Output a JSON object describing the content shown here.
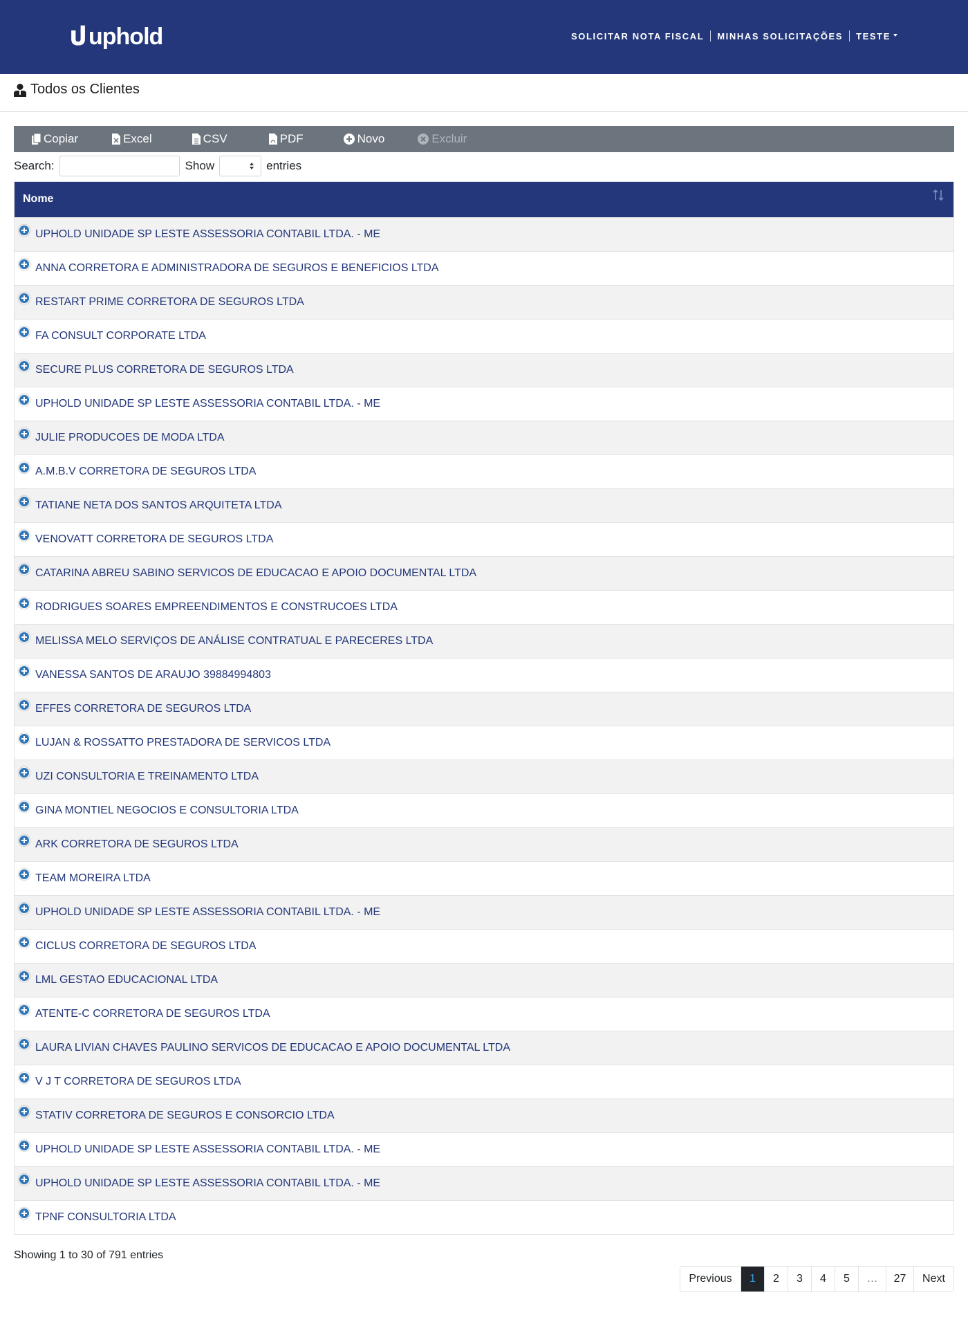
{
  "brand": {
    "name": "uphold"
  },
  "nav": {
    "links": [
      {
        "label": "SOLICITAR NOTA FISCAL"
      },
      {
        "label": "MINHAS SOLICITAÇÕES"
      },
      {
        "label": "TESTE"
      }
    ]
  },
  "page": {
    "title": "Todos os Clientes",
    "icon": "user-icon"
  },
  "toolbar": {
    "buttons": [
      {
        "label": "Copiar",
        "icon": "copy-icon",
        "enabled": true
      },
      {
        "label": "Excel",
        "icon": "excel-file-icon",
        "enabled": true
      },
      {
        "label": "CSV",
        "icon": "csv-file-icon",
        "enabled": true
      },
      {
        "label": "PDF",
        "icon": "pdf-file-icon",
        "enabled": true
      },
      {
        "label": "Novo",
        "icon": "plus-circle-icon",
        "enabled": true
      },
      {
        "label": "Excluir",
        "icon": "x-circle-icon",
        "enabled": false
      }
    ]
  },
  "controls": {
    "search_label": "Search:",
    "search_value": "",
    "show_label": "Show",
    "show_value": "",
    "entries_label": "entries"
  },
  "table": {
    "column": "Nome",
    "rows": [
      "UPHOLD UNIDADE SP LESTE ASSESSORIA CONTABIL LTDA. - ME",
      "ANNA CORRETORA E ADMINISTRADORA DE SEGUROS E BENEFICIOS LTDA",
      "RESTART PRIME CORRETORA DE SEGUROS LTDA",
      "FA CONSULT CORPORATE LTDA",
      "SECURE PLUS CORRETORA DE SEGUROS LTDA",
      "UPHOLD UNIDADE SP LESTE ASSESSORIA CONTABIL LTDA. - ME",
      "JULIE PRODUCOES DE MODA LTDA",
      "A.M.B.V CORRETORA DE SEGUROS LTDA",
      "TATIANE NETA DOS SANTOS ARQUITETA LTDA",
      "VENOVATT CORRETORA DE SEGUROS LTDA",
      "CATARINA ABREU SABINO SERVICOS DE EDUCACAO E APOIO DOCUMENTAL LTDA",
      "RODRIGUES SOARES EMPREENDIMENTOS E CONSTRUCOES LTDA",
      "MELISSA MELO SERVIÇOS DE ANÁLISE CONTRATUAL E PARECERES LTDA",
      "VANESSA SANTOS DE ARAUJO 39884994803",
      "EFFES CORRETORA DE SEGUROS LTDA",
      "LUJAN & ROSSATTO PRESTADORA DE SERVICOS LTDA",
      "UZI CONSULTORIA E TREINAMENTO LTDA",
      "GINA MONTIEL NEGOCIOS E CONSULTORIA LTDA",
      "ARK CORRETORA DE SEGUROS LTDA",
      "TEAM MOREIRA LTDA",
      "UPHOLD UNIDADE SP LESTE ASSESSORIA CONTABIL LTDA. - ME",
      "CICLUS CORRETORA DE SEGUROS LTDA",
      "LML GESTAO EDUCACIONAL LTDA",
      "ATENTE-C CORRETORA DE SEGUROS LTDA",
      "LAURA LIVIAN CHAVES PAULINO SERVICOS DE EDUCACAO E APOIO DOCUMENTAL LTDA",
      "V J T CORRETORA DE SEGUROS LTDA",
      "STATIV CORRETORA DE SEGUROS E CONSORCIO LTDA",
      "UPHOLD UNIDADE SP LESTE ASSESSORIA CONTABIL LTDA. - ME",
      "UPHOLD UNIDADE SP LESTE ASSESSORIA CONTABIL LTDA. - ME",
      "TPNF CONSULTORIA LTDA"
    ]
  },
  "info": "Showing 1 to 30 of 791 entries",
  "pagination": {
    "items": [
      "Previous",
      "1",
      "2",
      "3",
      "4",
      "5",
      "…",
      "27",
      "Next"
    ],
    "active": "1"
  },
  "colors": {
    "navbar": "#23377a",
    "toolbar": "#6c757d",
    "link_text": "#23377a",
    "expand_icon": "#2f76b7"
  }
}
